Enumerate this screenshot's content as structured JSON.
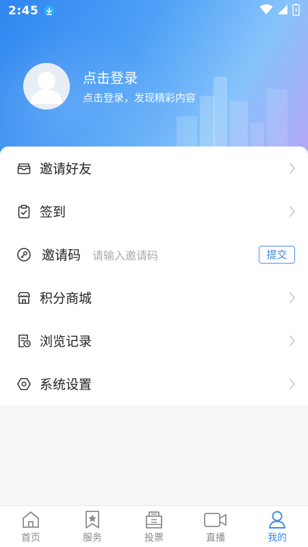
{
  "status_bar": {
    "time": "2:45"
  },
  "profile": {
    "title": "点击登录",
    "subtitle": "点击登录，发现精彩内容"
  },
  "menu": {
    "invite_friends": {
      "label": "邀请好友",
      "icon": "mail-icon"
    },
    "sign_in": {
      "label": "签到",
      "icon": "clipboard-check-icon"
    },
    "invite_code": {
      "label": "邀请码",
      "placeholder": "请输入邀请码",
      "submit_label": "提交",
      "icon": "key-icon"
    },
    "points_mall": {
      "label": "积分商城",
      "icon": "store-icon"
    },
    "history": {
      "label": "浏览记录",
      "icon": "history-icon"
    },
    "settings": {
      "label": "系统设置",
      "icon": "hexagon-settings-icon"
    }
  },
  "bottom_nav": {
    "tabs": [
      {
        "label": "首页",
        "icon": "home-icon"
      },
      {
        "label": "服务",
        "icon": "star-bookmark-icon"
      },
      {
        "label": "投票",
        "icon": "ballot-box-icon"
      },
      {
        "label": "直播",
        "icon": "video-camera-icon"
      },
      {
        "label": "我的",
        "icon": "person-icon"
      }
    ],
    "active_index": 4
  },
  "colors": {
    "accent": "#3d86e6",
    "header_gradient_start": "#2f86f0",
    "header_gradient_end": "#b8a6f7"
  }
}
